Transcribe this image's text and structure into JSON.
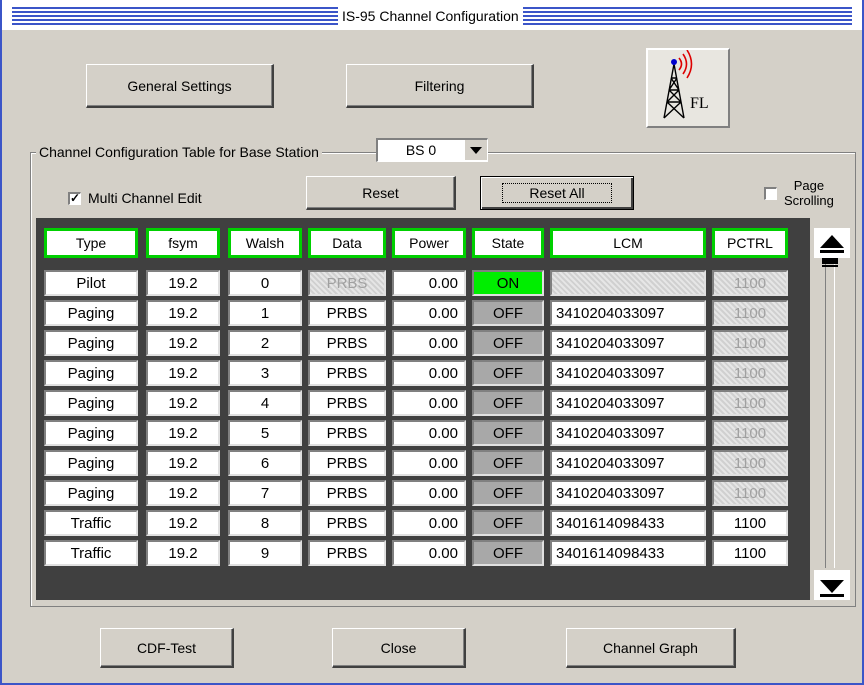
{
  "window": {
    "title": "IS-95 Channel Configuration"
  },
  "buttons": {
    "general_settings": "General Settings",
    "filtering": "Filtering",
    "reset": "Reset",
    "reset_all": "Reset All",
    "cdf_test": "CDF-Test",
    "close": "Close",
    "channel_graph": "Channel Graph"
  },
  "tower_label": "FL",
  "group": {
    "label": "Channel Configuration Table for Base Station",
    "base_station": "BS 0"
  },
  "options": {
    "multi_channel_edit": "Multi Channel Edit",
    "multi_channel_checked": "✓",
    "page_scrolling_1": "Page",
    "page_scrolling_2": "Scrolling"
  },
  "table": {
    "headers": [
      "Type",
      "fsym",
      "Walsh",
      "Data",
      "Power",
      "State",
      "LCM",
      "PCTRL"
    ],
    "rows": [
      {
        "type": "Pilot",
        "fsym": "19.2",
        "walsh": "0",
        "data": "PRBS",
        "power": "0.00",
        "state": "ON",
        "lcm": "",
        "pctrl": "1100"
      },
      {
        "type": "Paging",
        "fsym": "19.2",
        "walsh": "1",
        "data": "PRBS",
        "power": "0.00",
        "state": "OFF",
        "lcm": "3410204033097",
        "pctrl": "1100"
      },
      {
        "type": "Paging",
        "fsym": "19.2",
        "walsh": "2",
        "data": "PRBS",
        "power": "0.00",
        "state": "OFF",
        "lcm": "3410204033097",
        "pctrl": "1100"
      },
      {
        "type": "Paging",
        "fsym": "19.2",
        "walsh": "3",
        "data": "PRBS",
        "power": "0.00",
        "state": "OFF",
        "lcm": "3410204033097",
        "pctrl": "1100"
      },
      {
        "type": "Paging",
        "fsym": "19.2",
        "walsh": "4",
        "data": "PRBS",
        "power": "0.00",
        "state": "OFF",
        "lcm": "3410204033097",
        "pctrl": "1100"
      },
      {
        "type": "Paging",
        "fsym": "19.2",
        "walsh": "5",
        "data": "PRBS",
        "power": "0.00",
        "state": "OFF",
        "lcm": "3410204033097",
        "pctrl": "1100"
      },
      {
        "type": "Paging",
        "fsym": "19.2",
        "walsh": "6",
        "data": "PRBS",
        "power": "0.00",
        "state": "OFF",
        "lcm": "3410204033097",
        "pctrl": "1100"
      },
      {
        "type": "Paging",
        "fsym": "19.2",
        "walsh": "7",
        "data": "PRBS",
        "power": "0.00",
        "state": "OFF",
        "lcm": "3410204033097",
        "pctrl": "1100"
      },
      {
        "type": "Traffic",
        "fsym": "19.2",
        "walsh": "8",
        "data": "PRBS",
        "power": "0.00",
        "state": "OFF",
        "lcm": "3401614098433",
        "pctrl": "1100"
      },
      {
        "type": "Traffic",
        "fsym": "19.2",
        "walsh": "9",
        "data": "PRBS",
        "power": "0.00",
        "state": "OFF",
        "lcm": "3401614098433",
        "pctrl": "1100"
      }
    ]
  },
  "colors": {
    "title_stripe": "#3b55c8",
    "header_border": "#00d000",
    "state_on": "#00ee00",
    "state_off": "#a8a8a8"
  }
}
